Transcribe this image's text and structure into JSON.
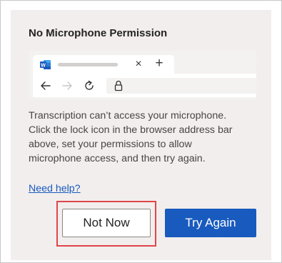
{
  "dialog": {
    "title": "No Microphone Permission",
    "message_lines": [
      "Transcription can’t access your microphone.",
      "Click the lock icon in the browser address bar",
      "above, set your permissions to allow",
      "microphone access, and then try again."
    ],
    "help_link": "Need help?",
    "secondary_button": "Not Now",
    "primary_button": "Try Again"
  },
  "browser_mock": {
    "tab_icon_letter": "W",
    "tab_close_glyph": "×",
    "new_tab_glyph": "+",
    "icons": [
      "word-app-icon",
      "close-icon",
      "plus-icon",
      "back-arrow-icon",
      "forward-arrow-icon",
      "refresh-icon",
      "lock-icon"
    ]
  },
  "colors": {
    "panel_background": "#f1eeed",
    "primary_button": "#185abd",
    "link": "#185abd",
    "highlight_border": "#e0454b",
    "word_brand": "#185abd"
  }
}
